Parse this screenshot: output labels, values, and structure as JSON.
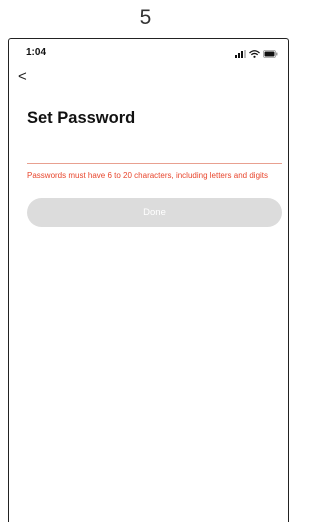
{
  "caption": {
    "page_number": "5"
  },
  "status_bar": {
    "time": "1:04"
  },
  "header": {
    "title": "Set Password",
    "back_glyph": "<"
  },
  "form": {
    "password_value": "",
    "error_message": "Passwords must have 6 to 20 characters, including letters and digits",
    "done_label": "Done"
  },
  "colors": {
    "error": "#e8452c",
    "input_underline": "#e8a090",
    "button_disabled_bg": "#dcdcdc"
  },
  "icons": [
    "signal-icon",
    "wifi-icon",
    "battery-icon",
    "back-chevron-icon"
  ]
}
